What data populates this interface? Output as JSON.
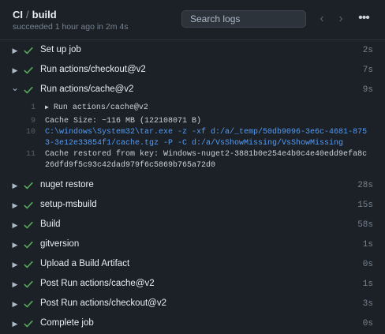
{
  "header": {
    "workflow": "CI",
    "separator": "/",
    "job": "build",
    "status_text": "succeeded 1 hour ago in 2m 4s",
    "search_placeholder": "Search logs"
  },
  "icons": {
    "prev": "chevron-left-icon",
    "next": "chevron-right-icon",
    "more": "kebab-horizontal-icon",
    "check": "check-circle-icon",
    "expand": "chevron-right-icon",
    "collapse": "chevron-down-icon"
  },
  "colors": {
    "success": "#57ab5a",
    "command": "#539bf5",
    "muted": "#768390"
  },
  "steps_before": [
    {
      "label": "Set up job",
      "duration": "2s"
    },
    {
      "label": "Run actions/checkout@v2",
      "duration": "7s"
    }
  ],
  "expanded_step": {
    "label": "Run actions/cache@v2",
    "duration": "9s",
    "log": [
      {
        "num": "1",
        "text": "Run actions/cache@v2",
        "group": true
      },
      {
        "num": "9",
        "text": "Cache Size: ~116 MB (122108071 B)"
      },
      {
        "num": "10",
        "text": "C:\\windows\\System32\\tar.exe -z -xf d:/a/_temp/50db9096-3e6c-4681-8753-3e12e33854f1/cache.tgz -P -C d:/a/VsShowMissing/VsShowMissing",
        "command": true
      },
      {
        "num": "11",
        "text": "Cache restored from key: Windows-nuget2-3881b0e254e4b0c4e40edd9efa8c26dfd9f5c93c42dad979f6c5869b765a72d0"
      }
    ]
  },
  "steps_after": [
    {
      "label": "nuget restore",
      "duration": "28s"
    },
    {
      "label": "setup-msbuild",
      "duration": "15s"
    },
    {
      "label": "Build",
      "duration": "58s"
    },
    {
      "label": "gitversion",
      "duration": "1s"
    },
    {
      "label": "Upload a Build Artifact",
      "duration": "0s"
    },
    {
      "label": "Post Run actions/cache@v2",
      "duration": "1s"
    },
    {
      "label": "Post Run actions/checkout@v2",
      "duration": "3s"
    },
    {
      "label": "Complete job",
      "duration": "0s"
    }
  ]
}
